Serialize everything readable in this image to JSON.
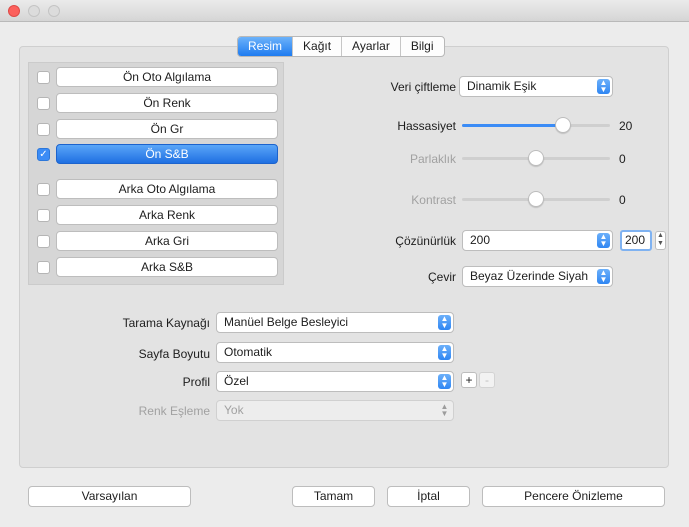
{
  "tabs": [
    "Resim",
    "Kağıt",
    "Ayarlar",
    "Bilgi"
  ],
  "side_front": [
    {
      "label": "Ön Oto Algılama",
      "checked": false
    },
    {
      "label": "Ön Renk",
      "checked": false
    },
    {
      "label": "Ön Gr",
      "checked": false
    },
    {
      "label": "Ön S&B",
      "checked": true
    }
  ],
  "side_back": [
    {
      "label": "Arka Oto Algılama",
      "checked": false
    },
    {
      "label": "Arka Renk",
      "checked": false
    },
    {
      "label": "Arka Gri",
      "checked": false
    },
    {
      "label": "Arka S&B",
      "checked": false
    }
  ],
  "settings": {
    "veri_label": "Veri çiftleme",
    "veri_value": "Dinamik Eşik",
    "hassasiyet_label": "Hassasiyet",
    "hassasiyet_value": "20",
    "hassasiyet_level": 0.68,
    "parlaklik_label": "Parlaklık",
    "parlaklik_value": "0",
    "parlaklik_level": 0.5,
    "kontrast_label": "Kontrast",
    "kontrast_value": "0",
    "kontrast_level": 0.5,
    "cozunurluk_label": "Çözünürlük",
    "cozunurluk_value": "200",
    "cozunurluk_box": "200",
    "cevir_label": "Çevir",
    "cevir_value": "Beyaz Üzerinde Siyah"
  },
  "source": {
    "tarama_label": "Tarama Kaynağı",
    "tarama_value": "Manüel Belge Besleyici",
    "sayfa_label": "Sayfa Boyutu",
    "sayfa_value": "Otomatik",
    "profil_label": "Profil",
    "profil_value": "Özel",
    "renk_label": "Renk Eşleme",
    "renk_value": "Yok",
    "plus": "+",
    "minus": "-"
  },
  "buttons": {
    "defaults": "Varsayılan",
    "ok": "Tamam",
    "cancel": "İptal",
    "preview": "Pencere Önizleme"
  },
  "colors": {
    "accent": "#1e7bf0",
    "close": "#fc605c"
  }
}
